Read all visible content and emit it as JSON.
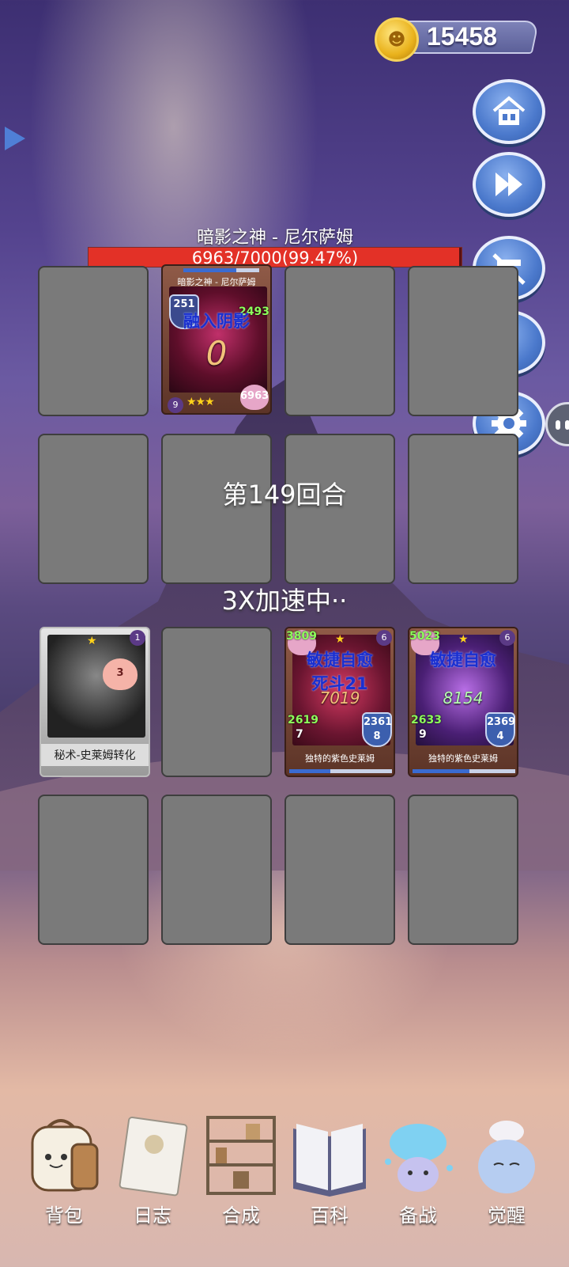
{
  "header": {
    "coins": "15458",
    "coin_icon": "coin-icon"
  },
  "side_buttons": [
    {
      "name": "home-button",
      "icon": "home-icon"
    },
    {
      "name": "fast-forward-button",
      "icon": "fast-forward-icon"
    },
    {
      "name": "auto-off-button",
      "icon": "auto-off-icon"
    },
    {
      "name": "alert-button",
      "icon": "exclamation-icon"
    },
    {
      "name": "settings-button",
      "icon": "gear-icon"
    }
  ],
  "boss": {
    "name": "暗影之神 - 尼尔萨姆",
    "hp_text": "6963/7000(99.47%)",
    "hp_fraction": 0.9947
  },
  "battle": {
    "round": "第149回合",
    "speed": "3X加速中··"
  },
  "enemy_card": {
    "title": "暗影之神 - 尼尔萨姆",
    "status": "融入阴影",
    "armor": "251",
    "attack": "2493",
    "big_number": "0",
    "level": "9",
    "stars": "★★★",
    "hp": "6963"
  },
  "player_cards": [
    {
      "title": "秘术-史莱姆转化",
      "level": "1",
      "cost": "3"
    },
    {
      "title": "独特的紫色史莱姆",
      "hp": "3809",
      "stars": "★",
      "level": "6",
      "status_line1": "敏捷自愈",
      "status_line2": "死斗21",
      "big_number": "7019",
      "attack": "2619",
      "attack_count": "7",
      "armor": "2361",
      "armor_count": "8"
    },
    {
      "title": "独特的紫色史莱姆",
      "hp": "5023",
      "stars": "★",
      "level": "6",
      "status_line1": "敏捷自愈",
      "big_number": "8154",
      "attack": "2633",
      "attack_count": "9",
      "armor": "2369",
      "armor_count": "4"
    }
  ],
  "bottom_nav": [
    {
      "label": "背包",
      "icon": "backpack-icon"
    },
    {
      "label": "日志",
      "icon": "journal-icon"
    },
    {
      "label": "合成",
      "icon": "crafting-shelf-icon"
    },
    {
      "label": "百科",
      "icon": "book-icon"
    },
    {
      "label": "备战",
      "icon": "slime-icon"
    },
    {
      "label": "觉醒",
      "icon": "awaken-slime-icon"
    }
  ],
  "colors": {
    "boss_hp": "#e33127",
    "button_blue": "#4b79cc",
    "empty_slot": "#7a7a7a"
  }
}
